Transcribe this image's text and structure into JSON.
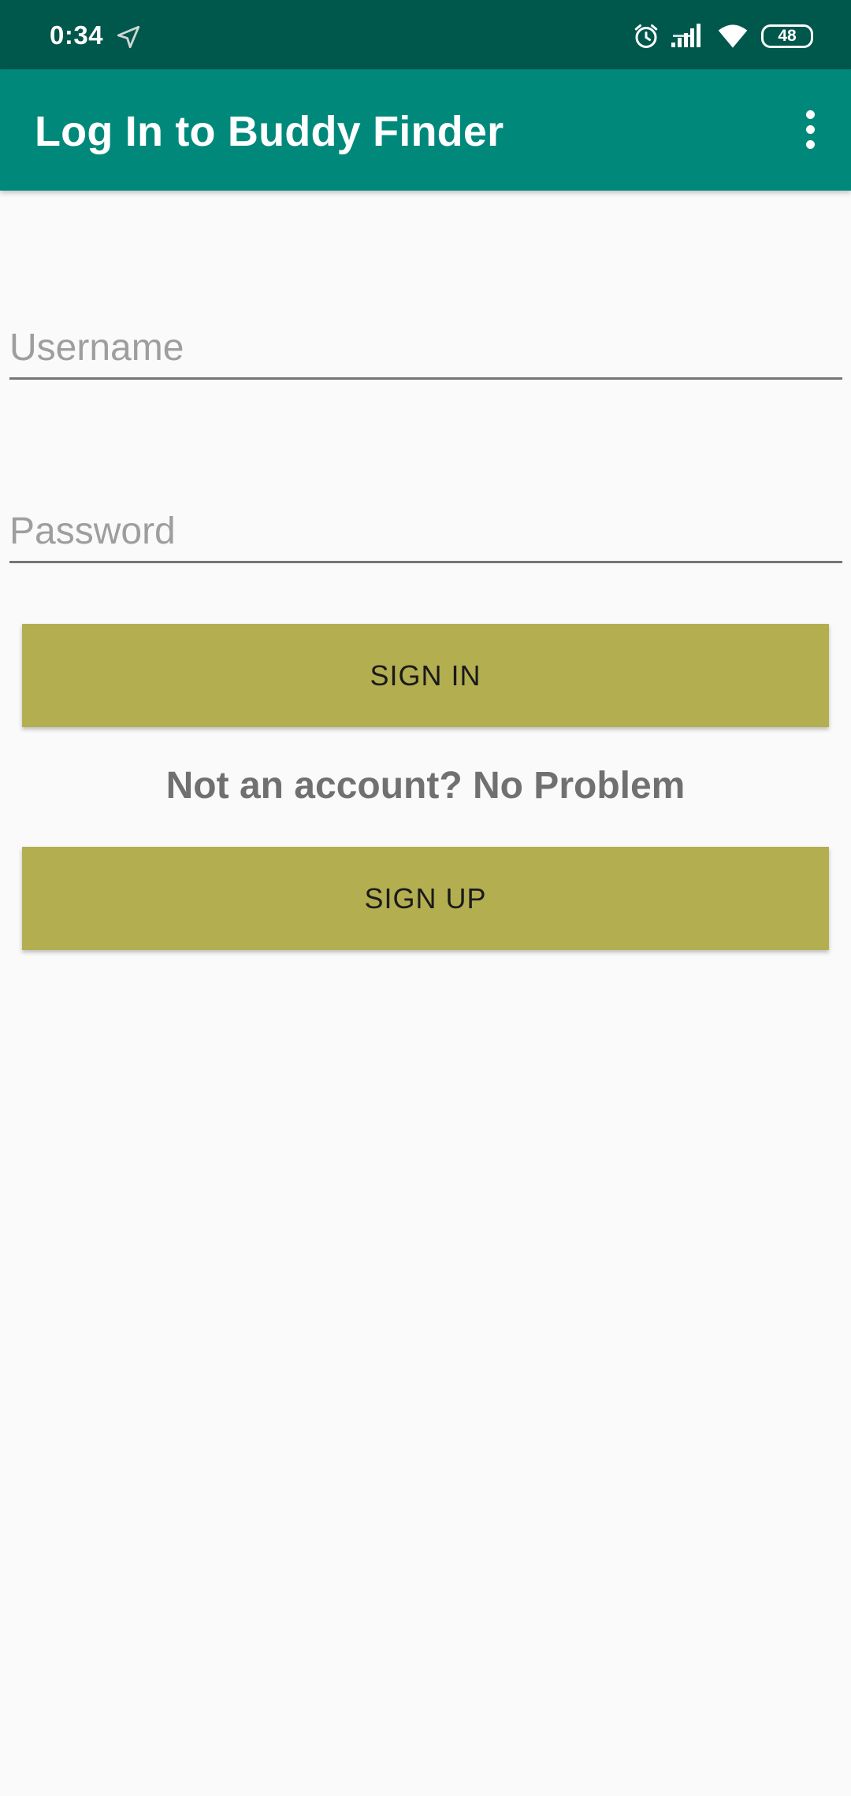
{
  "status_bar": {
    "time": "0:34",
    "battery": "48"
  },
  "app_bar": {
    "title": "Log In to Buddy Finder"
  },
  "form": {
    "username_placeholder": "Username",
    "username_value": "",
    "password_placeholder": "Password",
    "password_value": "",
    "sign_in_label": "SIGN IN",
    "prompt_text": "Not an account? No Problem",
    "sign_up_label": "SIGN UP"
  },
  "colors": {
    "status_bar": "#00574b",
    "app_bar": "#00897b",
    "button": "#b3ae50",
    "background": "#fafafa"
  },
  "icons": {
    "nav": "navigation-arrow-icon",
    "alarm": "alarm-icon",
    "signal": "signal-icon",
    "wifi": "wifi-icon",
    "battery": "battery-icon",
    "overflow": "more-vert-icon"
  }
}
